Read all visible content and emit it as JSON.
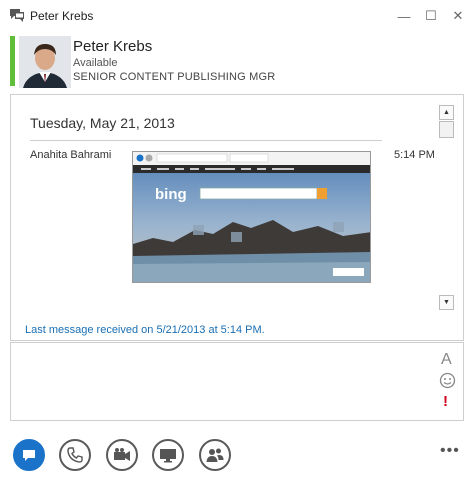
{
  "window": {
    "title": "Peter Krebs",
    "minimize_glyph": "—",
    "maximize_glyph": "☐",
    "close_glyph": "✕"
  },
  "contact": {
    "name": "Peter Krebs",
    "status": "Available",
    "job_title": "SENIOR CONTENT PUBLISHING MGR",
    "presence_color": "#5fbf3a"
  },
  "conversation": {
    "date": "Tuesday, May 21, 2013",
    "messages": [
      {
        "sender": "Anahita Bahrami",
        "time": "5:14 PM",
        "attachment": "bing-screenshot-image"
      }
    ],
    "last_message": "Last message received on 5/21/2013 at 5:14 PM.",
    "scroll_up_glyph": "▲",
    "scroll_down_glyph": "▼"
  },
  "compose": {
    "font_icon_glyph": "A",
    "emoticon_icon": "smiley-icon",
    "importance_glyph": "!"
  },
  "actions": {
    "items": [
      {
        "name": "im",
        "icon": "chat-bubble-icon",
        "active": true
      },
      {
        "name": "call",
        "icon": "phone-icon",
        "active": false
      },
      {
        "name": "video",
        "icon": "video-camera-icon",
        "active": false
      },
      {
        "name": "present",
        "icon": "monitor-icon",
        "active": false
      },
      {
        "name": "participants",
        "icon": "people-icon",
        "active": false
      }
    ],
    "more_glyph": "•••"
  },
  "colors": {
    "accent": "#1a73c8",
    "link": "#1a6fb3",
    "importance": "#d0021b"
  }
}
